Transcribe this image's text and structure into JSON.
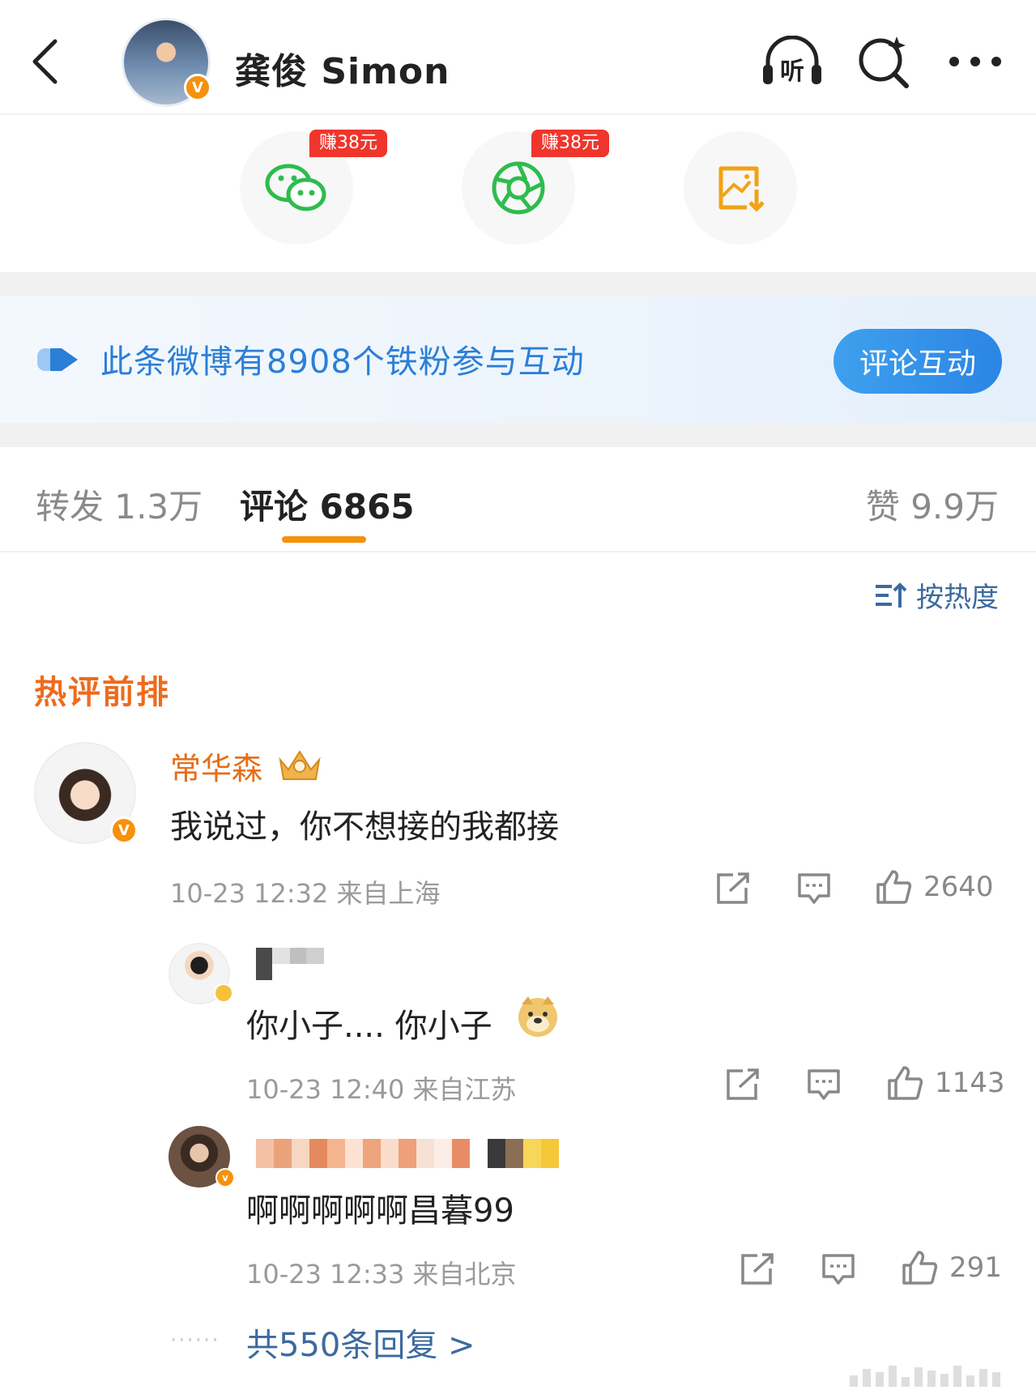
{
  "header": {
    "title": "龚俊 Simon",
    "listen_label": "听",
    "badge": "V"
  },
  "share": {
    "items": [
      {
        "name": "wechat",
        "tag": "赚38元"
      },
      {
        "name": "moments",
        "tag": "赚38元"
      },
      {
        "name": "save-image",
        "tag": ""
      }
    ]
  },
  "banner": {
    "text": "此条微博有8908个铁粉参与互动",
    "button": "评论互动"
  },
  "tabs": {
    "repost": "转发 1.3万",
    "comment": "评论 6865",
    "like": "赞 9.9万"
  },
  "sort_label": "按热度",
  "hot_title": "热评前排",
  "comment": {
    "user": "常华森",
    "text": "我说过，你不想接的我都接",
    "meta": "10-23 12:32  来自上海",
    "likes": "2640",
    "badge": "V"
  },
  "replies": [
    {
      "text": "你小子.... 你小子",
      "meta": "10-23 12:40  来自江苏",
      "likes": "1143"
    },
    {
      "text": "啊啊啊啊啊昌暮99",
      "meta": "10-23 12:33  来自北京",
      "likes": "291"
    }
  ],
  "more_replies": "共550条回复 >",
  "colors": {
    "accent_orange": "#f7900a",
    "link_blue": "#3c6a9e",
    "banner_blue": "#2b7fd6",
    "tag_red": "#f0362c"
  }
}
